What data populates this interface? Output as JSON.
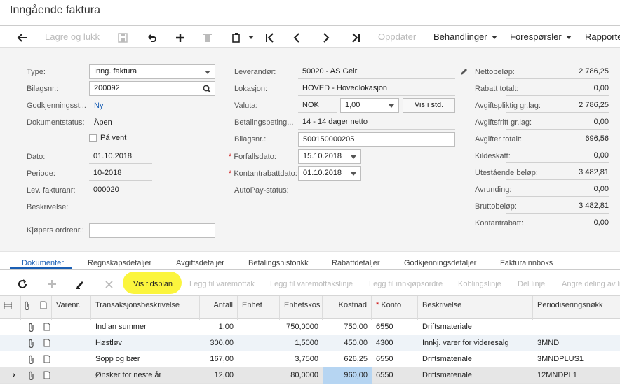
{
  "page": {
    "title": "Inngående faktura"
  },
  "toolbar": {
    "save_close": "Lagre og lukk",
    "update": "Oppdater",
    "processing": "Behandlinger",
    "inquiries": "Forespørsler",
    "reports": "Rapporte"
  },
  "form": {
    "type_label": "Type:",
    "type_value": "Inng. faktura",
    "refnbr_label": "Bilagsnr.:",
    "refnbr_value": "200092",
    "approval_label": "Godkjenningsst...",
    "approval_value": "Ny",
    "status_label": "Dokumentstatus:",
    "status_value": "Åpen",
    "hold_label": "På vent",
    "date_label": "Dato:",
    "date_value": "01.10.2018",
    "period_label": "Periode:",
    "period_value": "10-2018",
    "vendor_ref_label": "Lev. fakturanr:",
    "vendor_ref_value": "000020",
    "desc_label": "Beskrivelse:",
    "desc_value": "",
    "buyer_order_label": "Kjøpers ordrenr.:",
    "buyer_order_value": "",
    "vendor_label": "Leverandør:",
    "vendor_value": "50020 - AS Geir",
    "location_label": "Lokasjon:",
    "location_value": "HOVED - Hovedlokasjon",
    "currency_label": "Valuta:",
    "currency_value": "NOK",
    "rate_value": "1,00",
    "view_base": "Vis i std.",
    "terms_label": "Betalingsbeting...",
    "terms_value": "14 - 14 dager netto",
    "docnbr_label": "Bilagsnr.:",
    "docnbr_value": "500150000205",
    "due_label": "Forfallsdato:",
    "due_value": "15.10.2018",
    "cashdisc_label": "Kontantrabattdato:",
    "cashdisc_value": "01.10.2018",
    "autopay_label": "AutoPay-status:"
  },
  "totals": [
    {
      "label": "Nettobeløp:",
      "value": "2 786,25"
    },
    {
      "label": "Rabatt totalt:",
      "value": "0,00"
    },
    {
      "label": "Avgiftspliktig gr.lag:",
      "value": "2 786,25"
    },
    {
      "label": "Avgiftsfritt gr.lag:",
      "value": "0,00"
    },
    {
      "label": "Avgifter totalt:",
      "value": "696,56"
    },
    {
      "label": "Kildeskatt:",
      "value": "0,00"
    },
    {
      "label": "Utestående beløp:",
      "value": "3 482,81"
    },
    {
      "label": "Avrunding:",
      "value": "0,00"
    },
    {
      "label": "Bruttobeløp:",
      "value": "3 482,81"
    },
    {
      "label": "Kontantrabatt:",
      "value": "0,00"
    }
  ],
  "tabs": [
    "Dokumenter",
    "Regnskapsdetaljer",
    "Avgiftsdetaljer",
    "Betalingshistorikk",
    "Rabattdetaljer",
    "Godkjenningsdetaljer",
    "Fakturainnboks"
  ],
  "grid_toolbar": {
    "schedule": "Vis tidsplan",
    "add_receipt": "Legg til varemottak",
    "add_receipt_line": "Legg til varemottakslinje",
    "add_po": "Legg til innkjøpsordre",
    "link_line": "Koblingslinje",
    "split_line": "Del linje",
    "undo_split": "Angre deling av li"
  },
  "grid": {
    "headers": [
      "Varenr.",
      "Transaksjonsbeskrivelse",
      "Antall",
      "Enhet",
      "Enhetskos",
      "Kostnad",
      "Konto",
      "Beskrivelse",
      "Periodiseringsnøkk"
    ],
    "rows": [
      {
        "desc": "Indian summer",
        "qty": "1,00",
        "unit": "",
        "unitcost": "750,0000",
        "cost": "750,00",
        "account": "6550",
        "accdesc": "Driftsmateriale",
        "schedule": ""
      },
      {
        "desc": "Høstløv",
        "qty": "300,00",
        "unit": "",
        "unitcost": "1,5000",
        "cost": "450,00",
        "account": "4300",
        "accdesc": "Innkj. varer for videresalg",
        "schedule": "3MND"
      },
      {
        "desc": "Sopp og bær",
        "qty": "167,00",
        "unit": "",
        "unitcost": "3,7500",
        "cost": "626,25",
        "account": "6550",
        "accdesc": "Driftsmateriale",
        "schedule": "3MNDPLUS1"
      },
      {
        "desc": "Ønsker for neste år",
        "qty": "12,00",
        "unit": "",
        "unitcost": "80,0000",
        "cost": "960,00",
        "account": "6550",
        "accdesc": "Driftsmateriale",
        "schedule": "12MNDPL1"
      }
    ]
  }
}
